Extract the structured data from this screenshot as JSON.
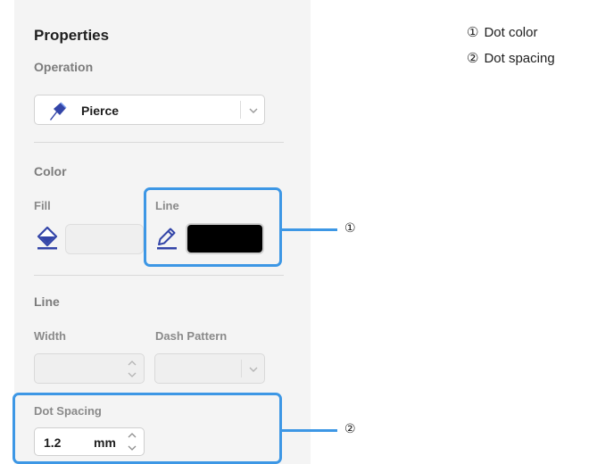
{
  "panel": {
    "title": "Properties",
    "operation": {
      "label": "Operation",
      "selected": "Pierce",
      "icon": "pierce-tool-icon"
    },
    "color": {
      "label": "Color",
      "fill_label": "Fill",
      "line_label": "Line",
      "line_color": "#000000",
      "fill_icon": "paint-bucket-icon",
      "line_icon": "pencil-icon"
    },
    "line": {
      "label": "Line",
      "width_label": "Width",
      "dash_label": "Dash Pattern"
    },
    "dot_spacing": {
      "label": "Dot Spacing",
      "value": "1.2",
      "unit": "mm"
    }
  },
  "callouts": [
    {
      "marker": "①",
      "text": "Dot color"
    },
    {
      "marker": "②",
      "text": "Dot spacing"
    }
  ],
  "colors": {
    "accent": "#3d97e5",
    "tool_icon": "#3345a8"
  }
}
